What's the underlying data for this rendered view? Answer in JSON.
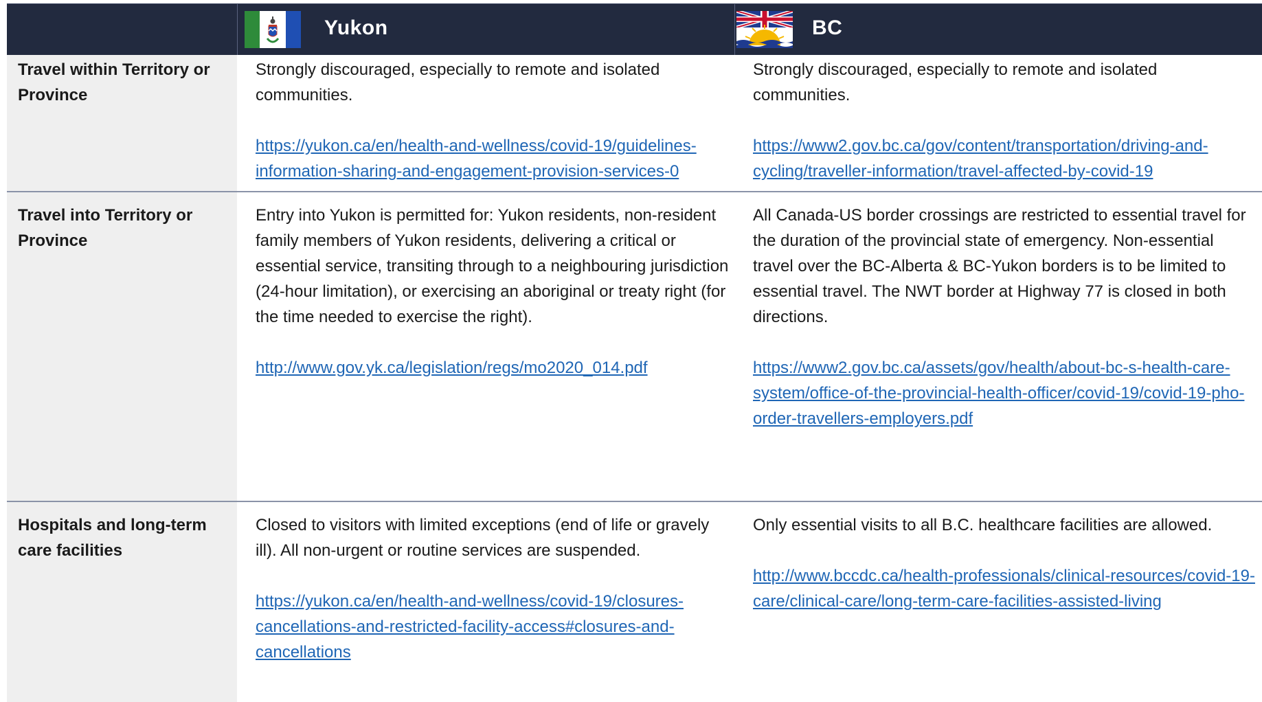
{
  "header": {
    "col1_label": "",
    "yukon_label": "Yukon",
    "bc_label": "BC"
  },
  "rows": [
    {
      "label": "Travel within Territory or Province",
      "yukon_text": "Strongly discouraged, especially to remote and isolated communities.",
      "yukon_link": "https://yukon.ca/en/health-and-wellness/covid-19/guidelines-information-sharing-and-engagement-provision-services-0",
      "bc_text": "Strongly discouraged, especially to remote and isolated communities.",
      "bc_link": "https://www2.gov.bc.ca/gov/content/transportation/driving-and-cycling/traveller-information/travel-affected-by-covid-19"
    },
    {
      "label": "Travel into Territory or Province",
      "yukon_text": "Entry into Yukon is permitted for: Yukon residents, non-resident family members of Yukon residents, delivering a critical or essential service, transiting through to a neighbouring jurisdiction (24-hour limitation), or exercising an aboriginal or treaty right (for the time needed to exercise the right).",
      "yukon_link": "http://www.gov.yk.ca/legislation/regs/mo2020_014.pdf",
      "bc_text": "All Canada-US border crossings are restricted to essential travel for the duration of the provincial state of emergency. Non-essential travel over the BC-Alberta & BC-Yukon borders is to be limited to essential travel. The NWT border at Highway 77 is closed in both directions.",
      "bc_link": "https://www2.gov.bc.ca/assets/gov/health/about-bc-s-health-care-system/office-of-the-provincial-health-officer/covid-19/covid-19-pho-order-travellers-employers.pdf"
    },
    {
      "label": "Hospitals and long-term care facilities",
      "yukon_text": "Closed to visitors with limited exceptions (end of life or gravely ill). All non-urgent or routine services are suspended.",
      "yukon_link": "https://yukon.ca/en/health-and-wellness/covid-19/closures-cancellations-and-restricted-facility-access#closures-and-cancellations",
      "bc_text": "Only essential visits to all B.C. healthcare facilities are allowed.",
      "bc_link": "http://www.bccdc.ca/health-professionals/clinical-resources/covid-19-care/clinical-care/long-term-care-facilities-assisted-living"
    }
  ]
}
